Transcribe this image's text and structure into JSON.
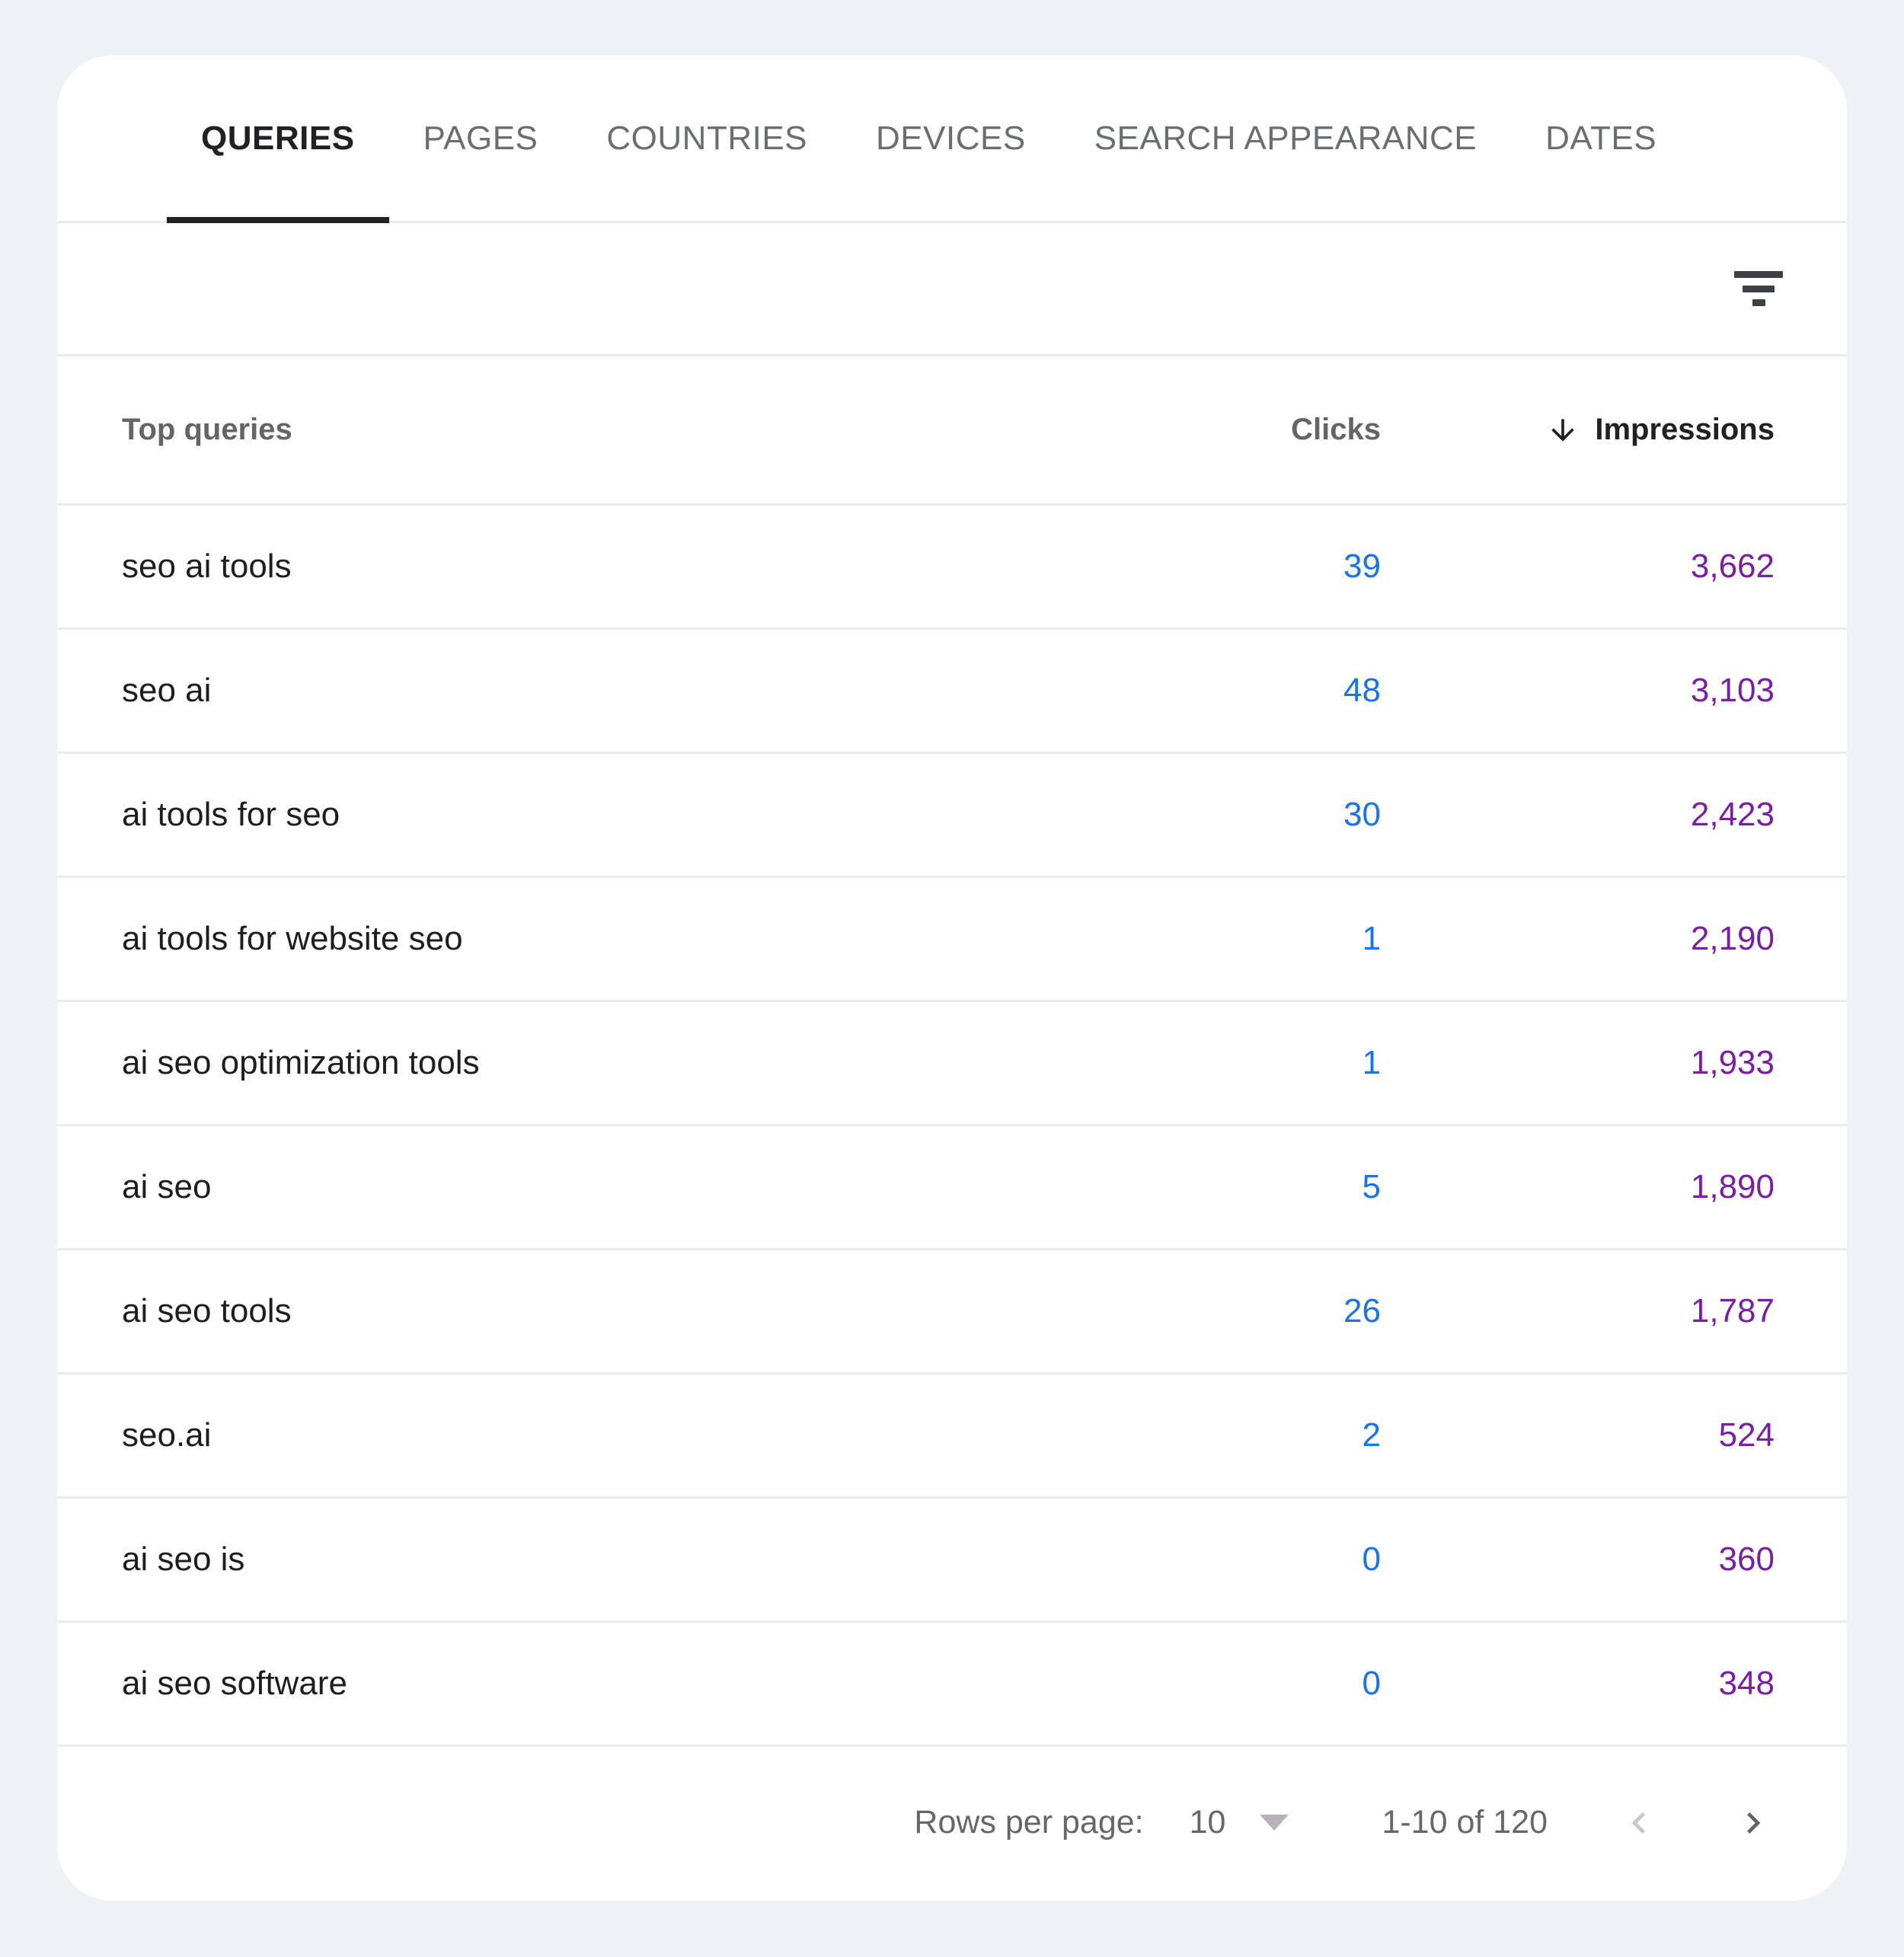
{
  "tabs": [
    {
      "label": "QUERIES",
      "active": true
    },
    {
      "label": "PAGES",
      "active": false
    },
    {
      "label": "COUNTRIES",
      "active": false
    },
    {
      "label": "DEVICES",
      "active": false
    },
    {
      "label": "SEARCH APPEARANCE",
      "active": false
    },
    {
      "label": "DATES",
      "active": false
    }
  ],
  "toolbar": {
    "filter_icon": "filter-list-icon"
  },
  "table": {
    "header": {
      "queries": "Top queries",
      "clicks": "Clicks",
      "impressions": "Impressions"
    },
    "sort": {
      "column": "Impressions",
      "direction": "desc",
      "icon": "arrow-down-icon"
    },
    "rows": [
      {
        "query": "seo ai tools",
        "clicks": "39",
        "impressions": "3,662"
      },
      {
        "query": "seo ai",
        "clicks": "48",
        "impressions": "3,103"
      },
      {
        "query": "ai tools for seo",
        "clicks": "30",
        "impressions": "2,423"
      },
      {
        "query": "ai tools for website seo",
        "clicks": "1",
        "impressions": "2,190"
      },
      {
        "query": "ai seo optimization tools",
        "clicks": "1",
        "impressions": "1,933"
      },
      {
        "query": "ai seo",
        "clicks": "5",
        "impressions": "1,890"
      },
      {
        "query": "ai seo tools",
        "clicks": "26",
        "impressions": "1,787"
      },
      {
        "query": "seo.ai",
        "clicks": "2",
        "impressions": "524"
      },
      {
        "query": "ai seo is",
        "clicks": "0",
        "impressions": "360"
      },
      {
        "query": "ai seo software",
        "clicks": "0",
        "impressions": "348"
      }
    ]
  },
  "pagination": {
    "rows_per_page_label": "Rows per page:",
    "rows_per_page_value": "10",
    "range_label": "1-10 of 120",
    "prev_enabled": false,
    "next_enabled": true
  },
  "colors": {
    "clicks_accent": "#1a73e8",
    "impressions_accent": "#7b1fa2",
    "active_tab_underline": "#212121",
    "page_background": "#eef1f6",
    "card_background": "#ffffff",
    "divider": "#e8eaed"
  }
}
